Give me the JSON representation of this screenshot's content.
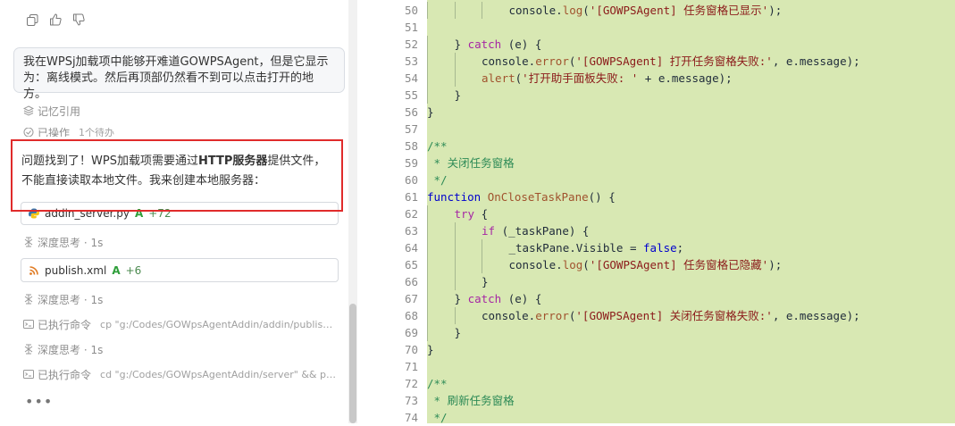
{
  "chat": {
    "user_message": "我在WPSj加载项中能够开难道GOWPSAgent，但是它显示为：离线模式。然后再顶部仍然看不到可以点击打开的地方。",
    "memory_label": "记忆引用",
    "ops_label": "已操作",
    "ops_count": "1个待办",
    "assistant_p1": "问题找到了！WPS加载项需要通过",
    "assistant_bold": "HTTP服务器",
    "assistant_p2": "提供文件，不能直接读取本地文件。我来创建本地服务器：",
    "files": [
      {
        "name": "addin_server.py",
        "badge": "A",
        "delta": "+72"
      },
      {
        "name": "publish.xml",
        "badge": "A",
        "delta": "+6"
      }
    ],
    "think1": "深度思考 · 1s",
    "think2": "深度思考 · 1s",
    "think3": "深度思考 · 1s",
    "cmd1_label": "已执行命令",
    "cmd1_text": "cp \"g:/Codes/GOWpsAgentAddin/addin/publish.xml\"...",
    "cmd2_label": "已执行命令",
    "cmd2_text": "cd \"g:/Codes/GOWpsAgentAddin/server\" && python...",
    "more": "•••"
  },
  "editor": {
    "lines": [
      {
        "n": "50",
        "indent": 3,
        "html_tokens": [
          [
            "n",
            "console."
          ],
          [
            "f",
            "log"
          ],
          [
            "n",
            "("
          ],
          [
            "s",
            "'[GOWPSAgent] 任务窗格已显示'"
          ],
          [
            "n",
            ");"
          ]
        ]
      },
      {
        "n": "51",
        "indent": 0,
        "html_tokens": []
      },
      {
        "n": "52",
        "indent": 1,
        "html_tokens": [
          [
            "n",
            "} "
          ],
          [
            "k",
            "catch"
          ],
          [
            "n",
            " (e) {"
          ]
        ]
      },
      {
        "n": "53",
        "indent": 2,
        "html_tokens": [
          [
            "n",
            "console."
          ],
          [
            "f",
            "error"
          ],
          [
            "n",
            "("
          ],
          [
            "s",
            "'[GOWPSAgent] 打开任务窗格失败:'"
          ],
          [
            "n",
            ", e.message);"
          ]
        ]
      },
      {
        "n": "54",
        "indent": 2,
        "html_tokens": [
          [
            "f",
            "alert"
          ],
          [
            "n",
            "("
          ],
          [
            "s",
            "'打开助手面板失败: '"
          ],
          [
            "n",
            " + e.message);"
          ]
        ]
      },
      {
        "n": "55",
        "indent": 1,
        "html_tokens": [
          [
            "n",
            "}"
          ]
        ]
      },
      {
        "n": "56",
        "indent": 0,
        "html_tokens": [
          [
            "n",
            "}"
          ]
        ]
      },
      {
        "n": "57",
        "indent": 0,
        "html_tokens": []
      },
      {
        "n": "58",
        "indent": 0,
        "html_tokens": [
          [
            "c",
            "/**"
          ]
        ]
      },
      {
        "n": "59",
        "indent": 0,
        "html_tokens": [
          [
            "c",
            " * 关闭任务窗格"
          ]
        ]
      },
      {
        "n": "60",
        "indent": 0,
        "html_tokens": [
          [
            "c",
            " */"
          ]
        ]
      },
      {
        "n": "61",
        "indent": 0,
        "html_tokens": [
          [
            "bl",
            "function"
          ],
          [
            "n",
            " "
          ],
          [
            "f",
            "OnCloseTaskPane"
          ],
          [
            "n",
            "() {"
          ]
        ]
      },
      {
        "n": "62",
        "indent": 1,
        "html_tokens": [
          [
            "k",
            "try"
          ],
          [
            "n",
            " {"
          ]
        ]
      },
      {
        "n": "63",
        "indent": 2,
        "html_tokens": [
          [
            "k",
            "if"
          ],
          [
            "n",
            " (_taskPane) {"
          ]
        ]
      },
      {
        "n": "64",
        "indent": 3,
        "html_tokens": [
          [
            "n",
            "_taskPane.Visible = "
          ],
          [
            "bl",
            "false"
          ],
          [
            "n",
            ";"
          ]
        ]
      },
      {
        "n": "65",
        "indent": 3,
        "html_tokens": [
          [
            "n",
            "console."
          ],
          [
            "f",
            "log"
          ],
          [
            "n",
            "("
          ],
          [
            "s",
            "'[GOWPSAgent] 任务窗格已隐藏'"
          ],
          [
            "n",
            ");"
          ]
        ]
      },
      {
        "n": "66",
        "indent": 2,
        "html_tokens": [
          [
            "n",
            "}"
          ]
        ]
      },
      {
        "n": "67",
        "indent": 1,
        "html_tokens": [
          [
            "n",
            "} "
          ],
          [
            "k",
            "catch"
          ],
          [
            "n",
            " (e) {"
          ]
        ]
      },
      {
        "n": "68",
        "indent": 2,
        "html_tokens": [
          [
            "n",
            "console."
          ],
          [
            "f",
            "error"
          ],
          [
            "n",
            "("
          ],
          [
            "s",
            "'[GOWPSAgent] 关闭任务窗格失败:'"
          ],
          [
            "n",
            ", e.message);"
          ]
        ]
      },
      {
        "n": "69",
        "indent": 1,
        "html_tokens": [
          [
            "n",
            "}"
          ]
        ]
      },
      {
        "n": "70",
        "indent": 0,
        "html_tokens": [
          [
            "n",
            "}"
          ]
        ]
      },
      {
        "n": "71",
        "indent": 0,
        "html_tokens": []
      },
      {
        "n": "72",
        "indent": 0,
        "html_tokens": [
          [
            "c",
            "/**"
          ]
        ]
      },
      {
        "n": "73",
        "indent": 0,
        "html_tokens": [
          [
            "c",
            " * 刷新任务窗格"
          ]
        ]
      },
      {
        "n": "74",
        "indent": 0,
        "html_tokens": [
          [
            "c",
            " */"
          ]
        ]
      }
    ]
  },
  "colors": {
    "highlight_border": "#e02b2b",
    "code_background": "#d8e8b3"
  }
}
